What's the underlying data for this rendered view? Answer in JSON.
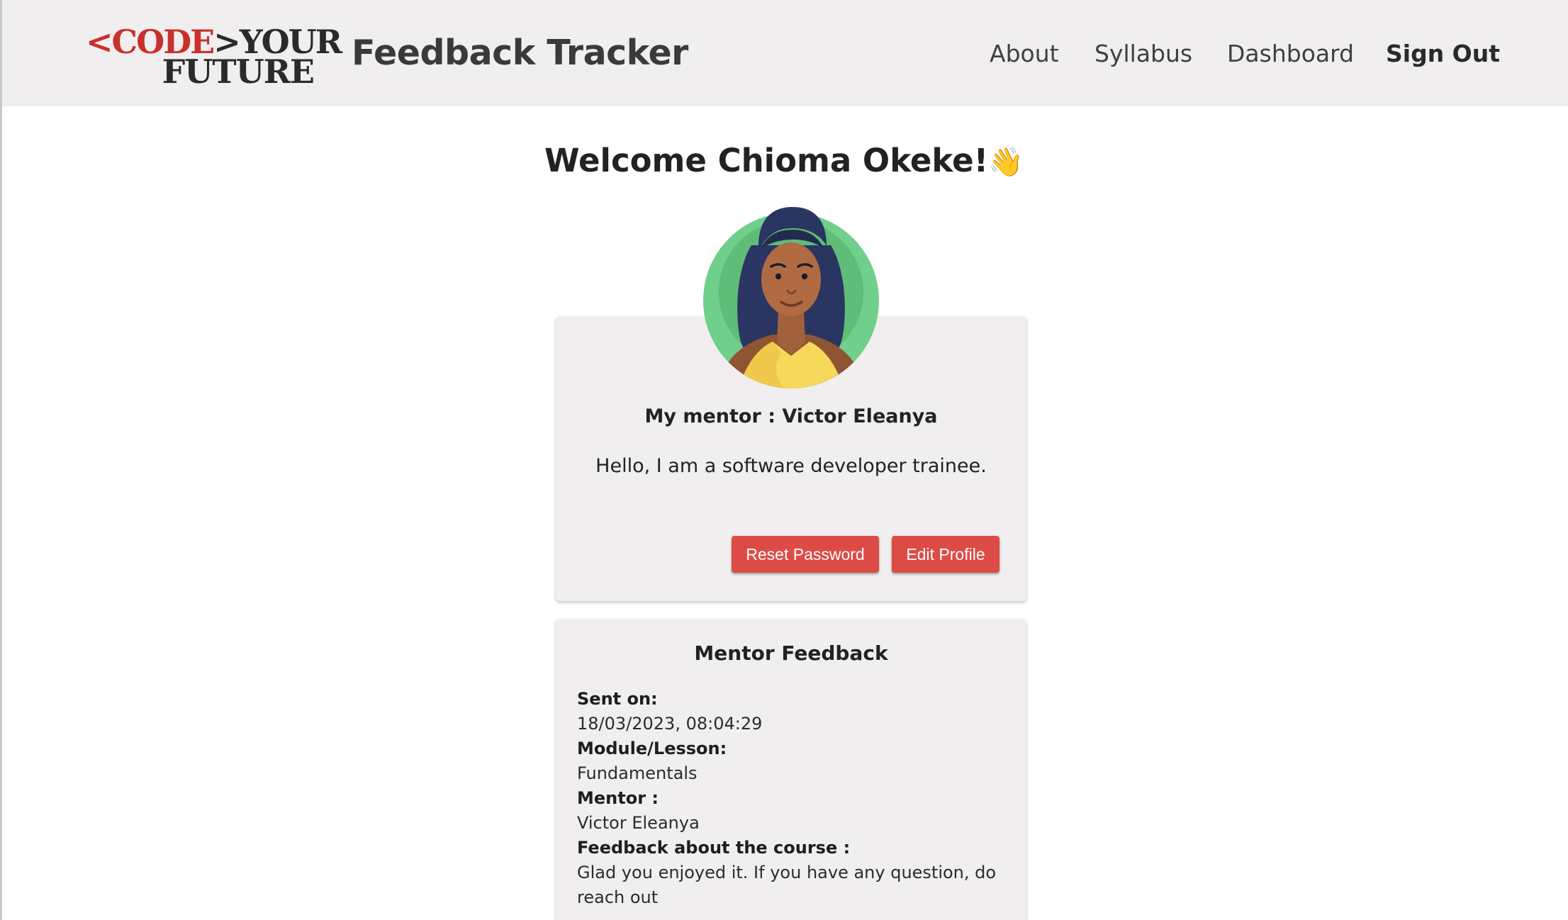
{
  "header": {
    "logo": {
      "line1_red": "<CODE",
      "line1_dark": ">YOUR",
      "line2": "FUTURE"
    },
    "app_title": "Feedback Tracker",
    "nav": {
      "about": "About",
      "syllabus": "Syllabus",
      "dashboard": "Dashboard",
      "sign_out": "Sign Out"
    }
  },
  "welcome": {
    "text": "Welcome Chioma Okeke!",
    "emoji": "👋"
  },
  "profile": {
    "avatar_icon": "woman-avatar",
    "mentor_line": "My mentor : Victor Eleanya",
    "bio": "Hello, I am a software developer trainee.",
    "buttons": {
      "reset_password": "Reset Password",
      "edit_profile": "Edit Profile"
    }
  },
  "feedback": {
    "title": "Mentor Feedback",
    "fields": [
      {
        "label": "Sent on:",
        "value": "18/03/2023, 08:04:29"
      },
      {
        "label": "Module/Lesson:",
        "value": "Fundamentals"
      },
      {
        "label": "Mentor :",
        "value": "Victor Eleanya"
      },
      {
        "label": "Feedback about the course :",
        "value": "Glad you enjoyed it. If you have any question, do reach out"
      }
    ]
  },
  "colors": {
    "header_bg": "#f0eeef",
    "accent_red": "#dd4b46",
    "logo_red": "#c8302d",
    "card_bg": "#f0eeef"
  }
}
